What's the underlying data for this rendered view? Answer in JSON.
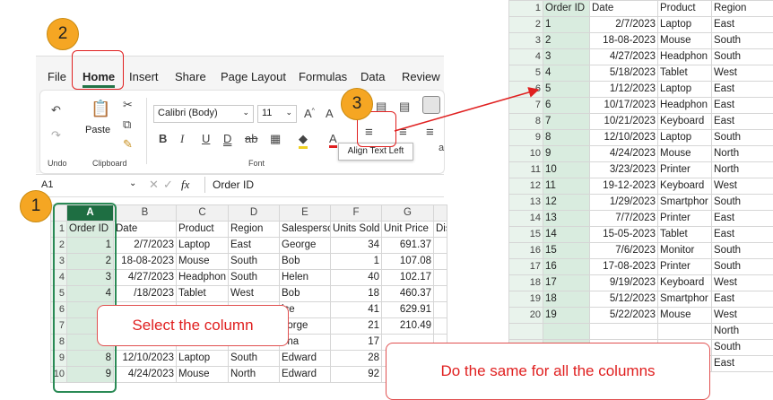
{
  "ribbon": {
    "tabs": [
      "File",
      "Home",
      "Insert",
      "Share",
      "Page Layout",
      "Formulas",
      "Data",
      "Review"
    ],
    "active_tab": "Home",
    "undo_label": "Undo",
    "paste_label": "Paste",
    "clipboard_label": "Clipboard",
    "font_name": "Calibri (Body)",
    "font_size": "11",
    "font_label": "Font",
    "tooltip": "Align Text Left"
  },
  "formula_bar": {
    "cell_ref": "A1",
    "fx": "fx",
    "content": "Order ID"
  },
  "left_grid": {
    "col_headers": [
      "A",
      "B",
      "C",
      "D",
      "E",
      "F",
      "G"
    ],
    "row1": [
      "Order ID",
      "Date",
      "Product",
      "Region",
      "Salesperso",
      "Units Sold",
      "Unit Price",
      "Dis"
    ],
    "rows": [
      {
        "n": "2",
        "a": "1",
        "b": "2/7/2023",
        "c": "Laptop",
        "d": "East",
        "e": "George",
        "f": "34",
        "g": "691.37"
      },
      {
        "n": "3",
        "a": "2",
        "b": "18-08-2023",
        "c": "Mouse",
        "d": "South",
        "e": "Bob",
        "f": "1",
        "g": "107.08"
      },
      {
        "n": "4",
        "a": "3",
        "b": "4/27/2023",
        "c": "Headphon",
        "d": "South",
        "e": "Helen",
        "f": "40",
        "g": "102.17"
      },
      {
        "n": "5",
        "a": "4",
        "b": "/18/2023",
        "c": "Tablet",
        "d": "West",
        "e": "Bob",
        "f": "18",
        "g": "460.37"
      },
      {
        "n": "6",
        "a": "",
        "b": "",
        "c": "",
        "d": "",
        "e": "ice",
        "f": "41",
        "g": "629.91"
      },
      {
        "n": "7",
        "a": "",
        "b": "",
        "c": "",
        "d": "",
        "e": "eorge",
        "f": "21",
        "g": "210.49"
      },
      {
        "n": "8",
        "a": "",
        "b": "",
        "c": "",
        "d": "",
        "e": "ona",
        "f": "17",
        "g": ""
      },
      {
        "n": "9",
        "a": "8",
        "b": "12/10/2023",
        "c": "Laptop",
        "d": "South",
        "e": "Edward",
        "f": "28",
        "g": ""
      },
      {
        "n": "10",
        "a": "9",
        "b": "4/24/2023",
        "c": "Mouse",
        "d": "North",
        "e": "Edward",
        "f": "92",
        "g": ""
      }
    ]
  },
  "right_grid": {
    "header": {
      "n": "1",
      "a": "Order ID",
      "b": "Date",
      "c": "Product",
      "d": "Region"
    },
    "rows": [
      {
        "n": "2",
        "a": "1",
        "b": "2/7/2023",
        "c": "Laptop",
        "d": "East"
      },
      {
        "n": "3",
        "a": "2",
        "b": "18-08-2023",
        "c": "Mouse",
        "d": "South"
      },
      {
        "n": "4",
        "a": "3",
        "b": "4/27/2023",
        "c": "Headphon",
        "d": "South"
      },
      {
        "n": "5",
        "a": "4",
        "b": "5/18/2023",
        "c": "Tablet",
        "d": "West"
      },
      {
        "n": "6",
        "a": "5",
        "b": "1/12/2023",
        "c": "Laptop",
        "d": "East"
      },
      {
        "n": "7",
        "a": "6",
        "b": "10/17/2023",
        "c": "Headphon",
        "d": "East"
      },
      {
        "n": "8",
        "a": "7",
        "b": "10/21/2023",
        "c": "Keyboard",
        "d": "East"
      },
      {
        "n": "9",
        "a": "8",
        "b": "12/10/2023",
        "c": "Laptop",
        "d": "South"
      },
      {
        "n": "10",
        "a": "9",
        "b": "4/24/2023",
        "c": "Mouse",
        "d": "North"
      },
      {
        "n": "11",
        "a": "10",
        "b": "3/23/2023",
        "c": "Printer",
        "d": "North"
      },
      {
        "n": "12",
        "a": "11",
        "b": "19-12-2023",
        "c": "Keyboard",
        "d": "West"
      },
      {
        "n": "13",
        "a": "12",
        "b": "1/29/2023",
        "c": "Smartphor",
        "d": "South"
      },
      {
        "n": "14",
        "a": "13",
        "b": "7/7/2023",
        "c": "Printer",
        "d": "East"
      },
      {
        "n": "15",
        "a": "14",
        "b": "15-05-2023",
        "c": "Tablet",
        "d": "East"
      },
      {
        "n": "16",
        "a": "15",
        "b": "7/6/2023",
        "c": "Monitor",
        "d": "South"
      },
      {
        "n": "17",
        "a": "16",
        "b": "17-08-2023",
        "c": "Printer",
        "d": "South"
      },
      {
        "n": "18",
        "a": "17",
        "b": "9/19/2023",
        "c": "Keyboard",
        "d": "West"
      },
      {
        "n": "19",
        "a": "18",
        "b": "5/12/2023",
        "c": "Smartphor",
        "d": "East"
      },
      {
        "n": "20",
        "a": "19",
        "b": "5/22/2023",
        "c": "Mouse",
        "d": "West"
      },
      {
        "n": "",
        "a": "",
        "b": "",
        "c": "",
        "d": "North"
      },
      {
        "n": "",
        "a": "",
        "b": "",
        "c": "",
        "d": "South"
      },
      {
        "n": "",
        "a": "",
        "b": "",
        "c": "",
        "d": "East"
      }
    ]
  },
  "annotations": {
    "step1": "1",
    "step2": "2",
    "step3": "3",
    "select_column": "Select the column",
    "do_same": "Do the same for all the columns"
  },
  "colors": {
    "accent": "#217346",
    "callout_red": "#e02020",
    "step_orange": "#f5a623"
  }
}
